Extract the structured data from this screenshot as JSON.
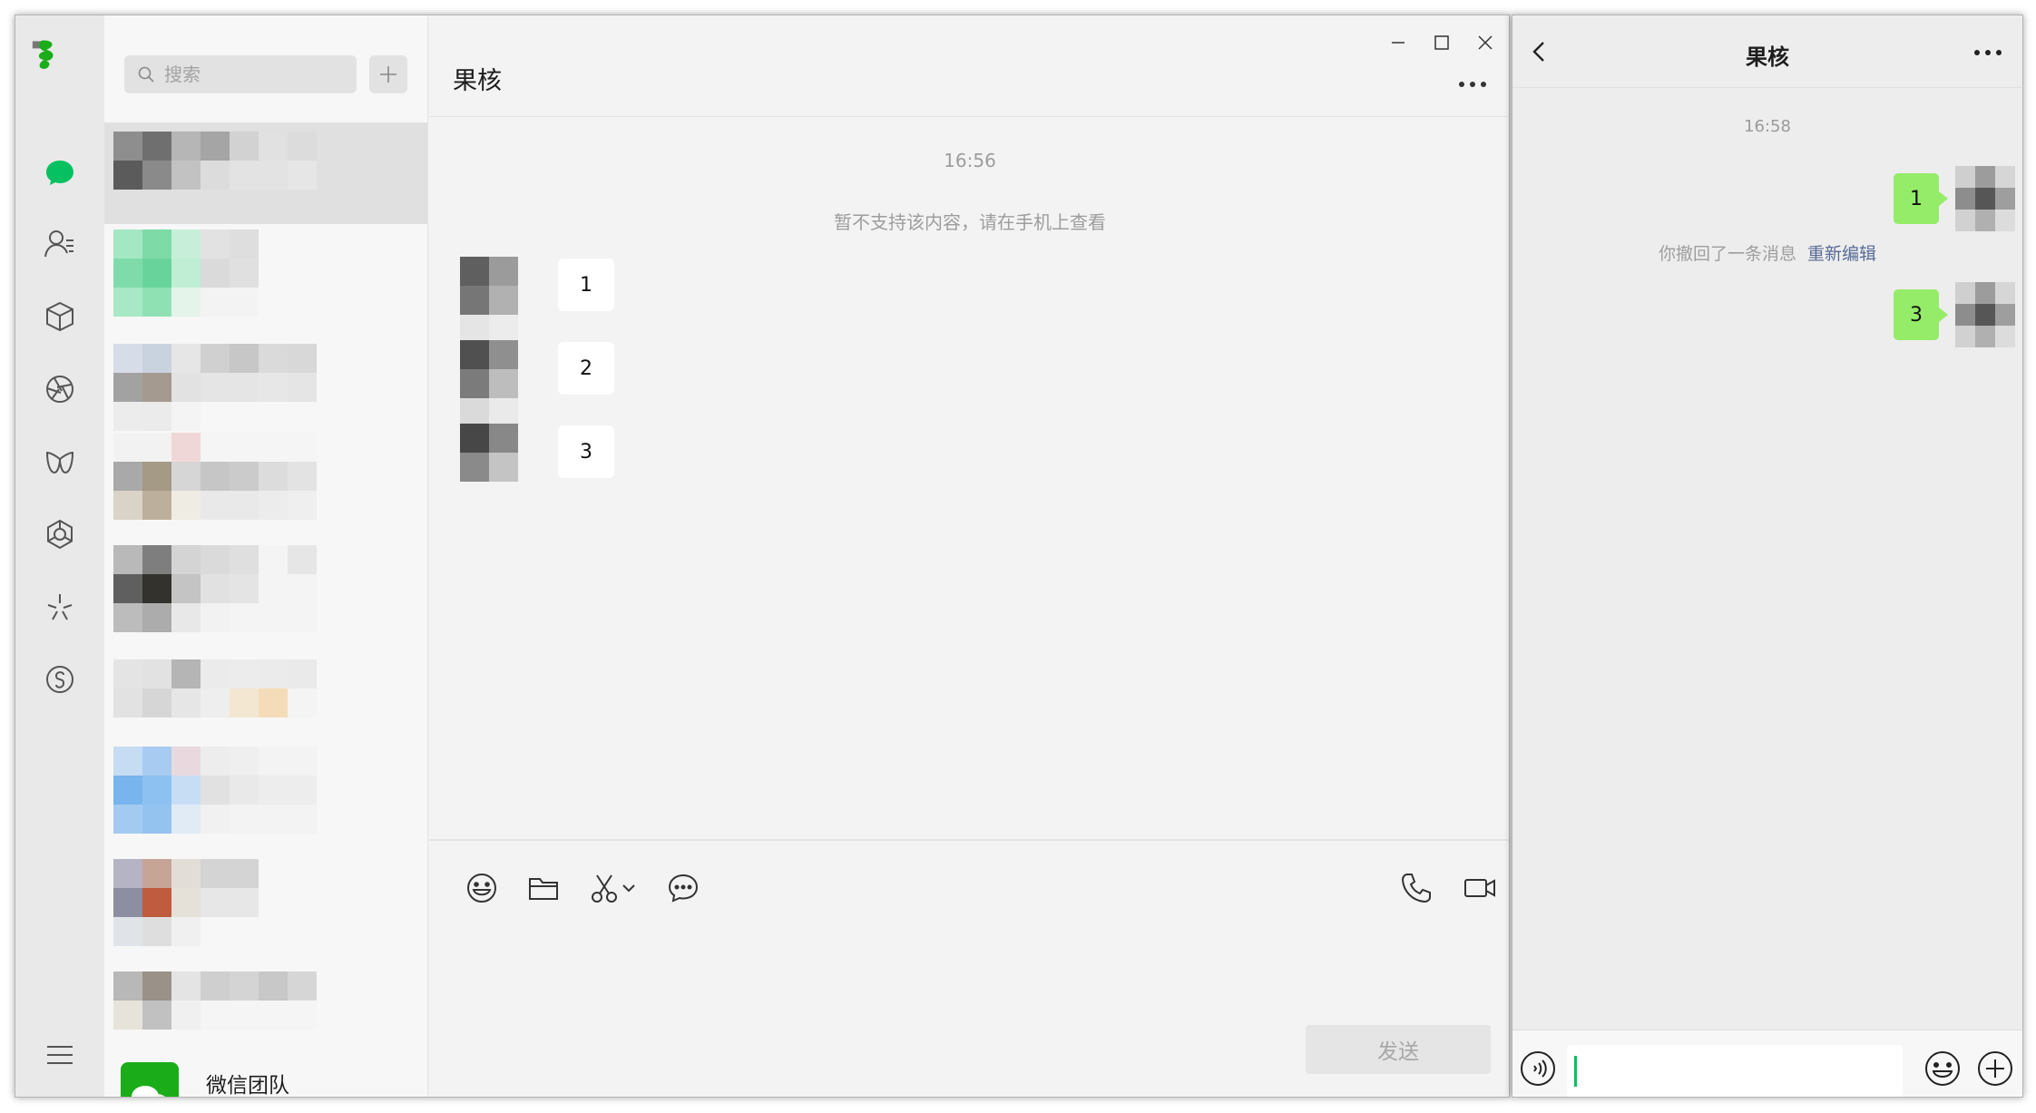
{
  "desktop": {
    "search": {
      "placeholder": "搜索"
    },
    "chat": {
      "title": "果核",
      "time": "16:56",
      "system_notice": "暂不支持该内容，请在手机上查看",
      "messages": [
        "1",
        "2",
        "3"
      ],
      "send_label": "发送"
    },
    "conversation_list": {
      "official": {
        "name": "微信团队"
      }
    }
  },
  "mobile": {
    "title": "果核",
    "time": "16:58",
    "messages": [
      "1",
      "3"
    ],
    "recall_notice": "你撤回了一条消息",
    "recall_action": "重新编辑"
  },
  "colors": {
    "accent_green": "#07c160",
    "bubble_green": "#95ec69",
    "link_blue": "#576b95"
  },
  "icons": [
    "chat-icon",
    "contacts-icon",
    "favorites-icon",
    "moments-icon",
    "channels-icon",
    "miniprogram-icon",
    "discover-icon",
    "search-icon",
    "menu-icon",
    "emoji-icon",
    "folder-icon",
    "scissors-icon",
    "bubble-icon",
    "phone-icon",
    "video-icon",
    "voice-icon",
    "plus-icon"
  ]
}
